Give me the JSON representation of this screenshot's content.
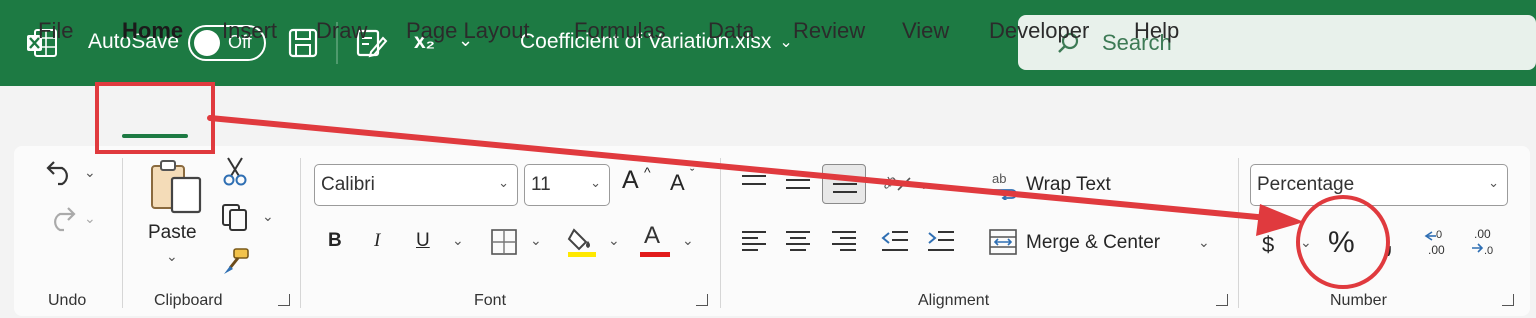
{
  "titlebar": {
    "autosave_label": "AutoSave",
    "autosave_state": "Off",
    "subscript_label": "x₂",
    "filename": "Coefficient of Variation.xlsx",
    "search_placeholder": "Search",
    "brand_color": "#1d7a43"
  },
  "tabs": [
    {
      "label": "File"
    },
    {
      "label": "Home",
      "active": true
    },
    {
      "label": "Insert"
    },
    {
      "label": "Draw"
    },
    {
      "label": "Page Layout"
    },
    {
      "label": "Formulas"
    },
    {
      "label": "Data"
    },
    {
      "label": "Review"
    },
    {
      "label": "View"
    },
    {
      "label": "Developer"
    },
    {
      "label": "Help"
    }
  ],
  "ribbon": {
    "undo_group": "Undo",
    "clipboard": {
      "group": "Clipboard",
      "paste_label": "Paste"
    },
    "font": {
      "group": "Font",
      "font_name": "Calibri",
      "font_size": "11",
      "bold": "B",
      "italic": "I",
      "underline": "U",
      "grow": "A",
      "shrink": "A",
      "font_color_glyph": "A"
    },
    "alignment": {
      "group": "Alignment",
      "wrap_text": "Wrap Text",
      "merge_center": "Merge & Center",
      "wrap_icon_text": "ab"
    },
    "number": {
      "group": "Number",
      "format": "Percentage",
      "currency_glyph": "$",
      "percent_glyph": "%",
      "comma_glyph": ",",
      "inc_decimal": ".00",
      "dec_decimal": ".00"
    }
  },
  "annotations": {
    "color": "#e03a3e"
  }
}
